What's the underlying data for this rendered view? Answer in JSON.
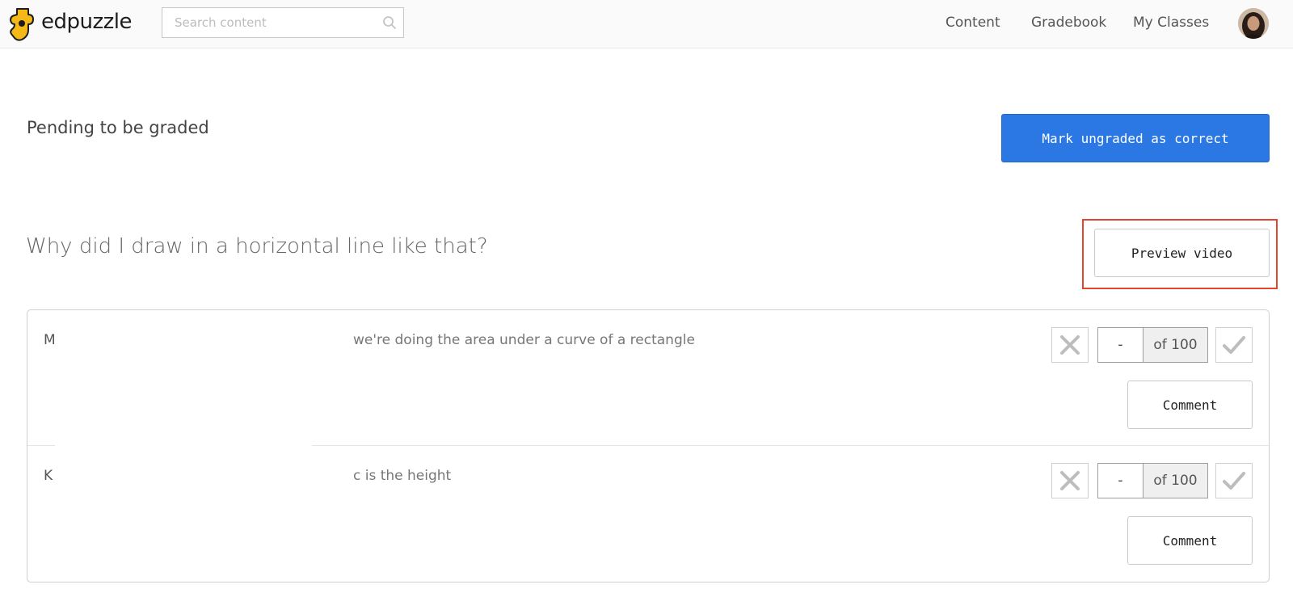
{
  "header": {
    "logo_text": "edpuzzle",
    "search": {
      "placeholder": "Search content",
      "value": ""
    },
    "nav": [
      "Content",
      "Gradebook",
      "My Classes"
    ]
  },
  "page": {
    "title": "Pending to be graded",
    "mark_ungraded_label": "Mark ungraded as correct"
  },
  "question": {
    "text": "Why did I draw in a horizontal line like that?",
    "preview_label": "Preview video"
  },
  "answers": [
    {
      "student_initial": "M",
      "text": "we're doing the area under a curve of a rectangle",
      "score": "-",
      "max": "of 100",
      "comment_label": "Comment"
    },
    {
      "student_initial": "K",
      "text": "c is the height",
      "score": "-",
      "max": "of 100",
      "comment_label": "Comment"
    }
  ],
  "colors": {
    "primary": "#2b78e4",
    "highlight": "#e2452e",
    "logo": "#f5b917"
  }
}
